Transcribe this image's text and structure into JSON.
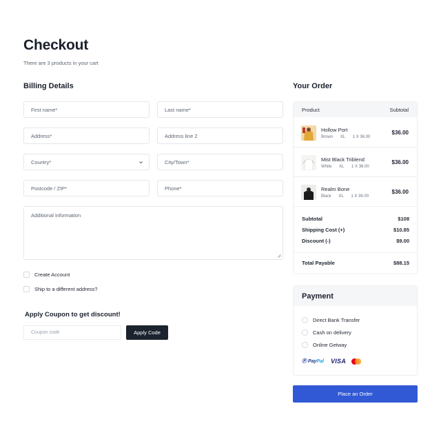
{
  "page": {
    "title": "Checkout",
    "subtitle": "There are 3 products in your cart"
  },
  "billing": {
    "heading": "Billing Details",
    "first_name": "First name*",
    "last_name": "Last name*",
    "address": "Address*",
    "address2": "Address line 2",
    "country": "Country*",
    "city": "City/Town*",
    "postcode": "Postcode / ZIP*",
    "phone": "Phone*",
    "additional": "Additional information",
    "create_account": "Create Account",
    "ship_different": "Ship to a different address?"
  },
  "coupon": {
    "heading": "Apply Coupon to get discount!",
    "placeholder": "Coupon code",
    "button": "Apply Code"
  },
  "order": {
    "heading": "Your Order",
    "col_product": "Product",
    "col_subtotal": "Subtotal",
    "items": [
      {
        "name": "Hollow Port",
        "color": "Brown",
        "size": "XL",
        "qty": "1 X 36.00",
        "price": "$36.00"
      },
      {
        "name": "Mist Black Triblend",
        "color": "White",
        "size": "XL",
        "qty": "1 X 36.00",
        "price": "$36.00"
      },
      {
        "name": "Realm Bone",
        "color": "Black",
        "size": "XL",
        "qty": "1 X 36.00",
        "price": "$36.00"
      }
    ],
    "subtotal_label": "Subtotal",
    "subtotal_value": "$108",
    "shipping_label": "Shipping Cost (+)",
    "shipping_value": "$10.85",
    "discount_label": "Discount (-)",
    "discount_value": "$9.00",
    "total_label": "Total Payable",
    "total_value": "$88.15"
  },
  "payment": {
    "heading": "Payment",
    "options": [
      "Direct Bank Transfer",
      "Cash on delivery",
      "Online Getway"
    ],
    "paypal_a": "Pay",
    "paypal_b": "Pal",
    "visa": "VISA"
  },
  "place_order": "Place an Order",
  "colors": {
    "primary": "#3159d6",
    "dark_button": "#1c232e",
    "border": "#e3e6ea",
    "header_bg": "#f5f6f7"
  }
}
